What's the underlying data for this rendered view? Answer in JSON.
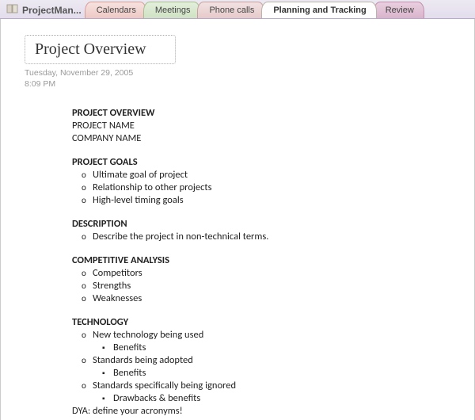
{
  "notebook_label": "ProjectMan...",
  "tabs": [
    {
      "label": "Calendars"
    },
    {
      "label": "Meetings"
    },
    {
      "label": "Phone calls"
    },
    {
      "label": "Planning and Tracking"
    },
    {
      "label": "Review"
    }
  ],
  "page": {
    "title": "Project Overview",
    "date": "Tuesday, November  29, 2005",
    "time": "8:09 PM"
  },
  "body": {
    "sec1": {
      "h": "PROJECT OVERVIEW",
      "l1": "PROJECT NAME",
      "l2": "COMPANY NAME"
    },
    "sec2": {
      "h": "PROJECT GOALS",
      "i1": "Ultimate goal of project",
      "i2": "Relationship to other projects",
      "i3": "High-level timing goals"
    },
    "sec3": {
      "h": "DESCRIPTION",
      "i1": "Describe the project in non-technical terms."
    },
    "sec4": {
      "h": "COMPETITIVE ANALYSIS",
      "i1": "Competitors",
      "i2": "Strengths",
      "i3": "Weaknesses"
    },
    "sec5": {
      "h": "TECHNOLOGY",
      "i1": "New technology being used",
      "i1a": "Benefits",
      "i2": "Standards being adopted",
      "i2a": "Benefits",
      "i3": "Standards specifically being ignored",
      "i3a": "Drawbacks & benefits",
      "note": "DYA: define your acronyms!"
    }
  }
}
